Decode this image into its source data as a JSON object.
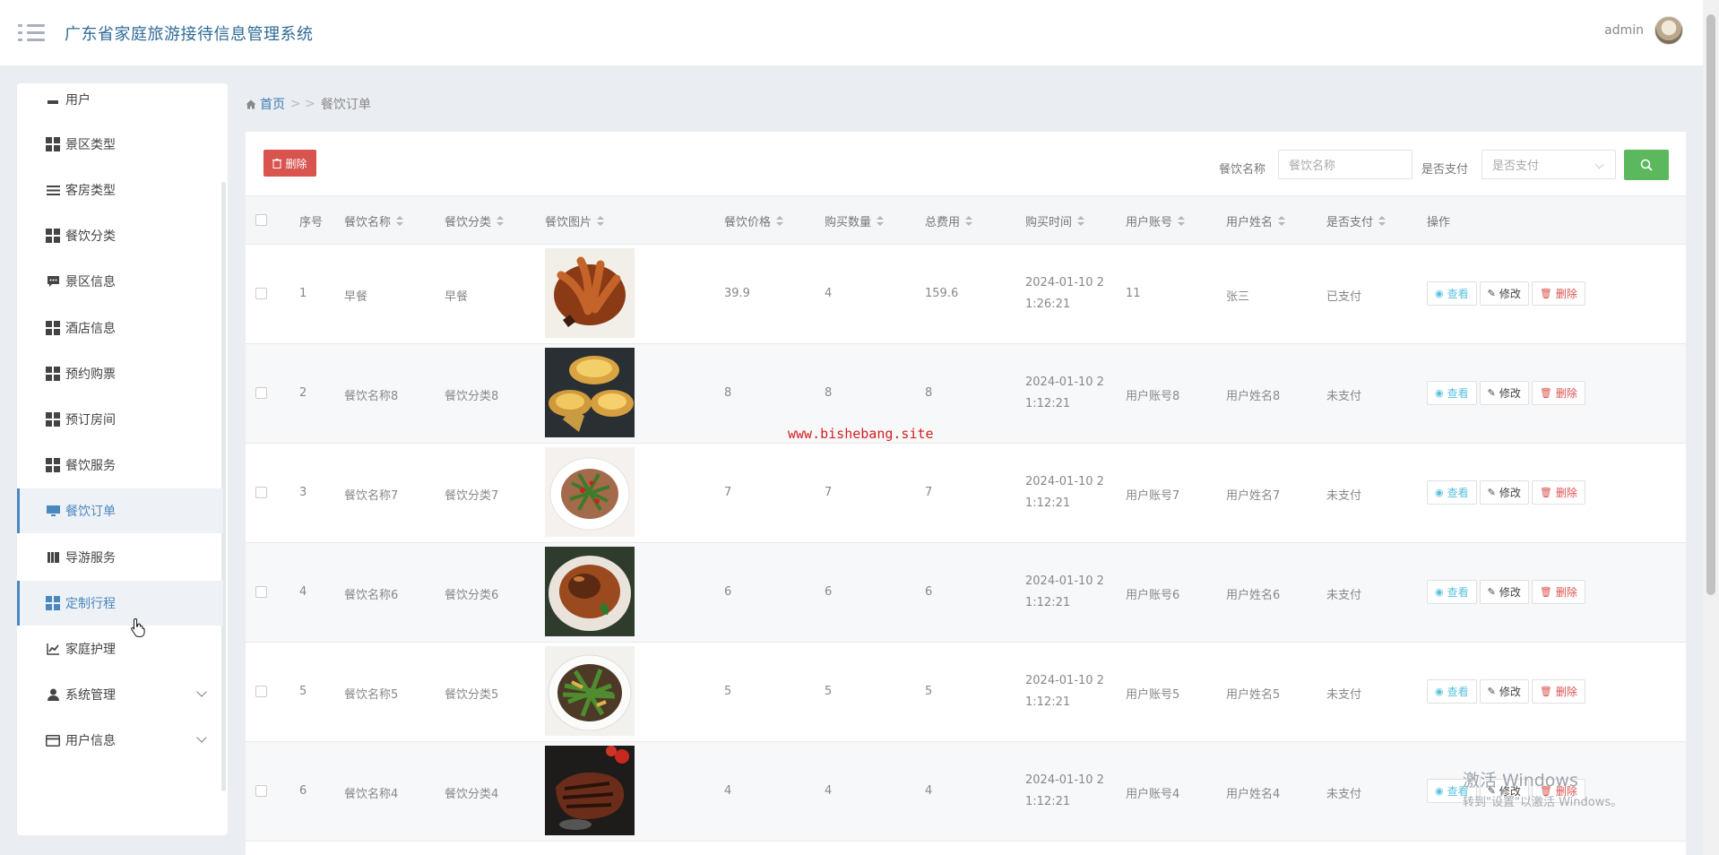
{
  "header": {
    "title": "广东省家庭旅游接待信息管理系统",
    "username": "admin"
  },
  "sidebar": {
    "items": [
      {
        "label": "用户",
        "icon": "user-icon"
      },
      {
        "label": "景区类型",
        "icon": "grid-icon"
      },
      {
        "label": "客房类型",
        "icon": "list-icon"
      },
      {
        "label": "餐饮分类",
        "icon": "grid-icon"
      },
      {
        "label": "景区信息",
        "icon": "comment-icon"
      },
      {
        "label": "酒店信息",
        "icon": "grid-icon"
      },
      {
        "label": "预约购票",
        "icon": "grid-icon"
      },
      {
        "label": "预订房间",
        "icon": "grid-icon"
      },
      {
        "label": "餐饮服务",
        "icon": "grid-icon"
      },
      {
        "label": "餐饮订单",
        "icon": "monitor-icon",
        "active": true
      },
      {
        "label": "导游服务",
        "icon": "book-icon"
      },
      {
        "label": "定制行程",
        "icon": "grid-icon",
        "active": true
      },
      {
        "label": "家庭护理",
        "icon": "chart-icon"
      },
      {
        "label": "系统管理",
        "icon": "person-icon",
        "expandable": true
      },
      {
        "label": "用户信息",
        "icon": "card-icon",
        "expandable": true
      }
    ]
  },
  "breadcrumb": {
    "home": "首页",
    "separator": "> >",
    "current": "餐饮订单"
  },
  "toolbar": {
    "delete_label": "删除",
    "search_name_label": "餐饮名称",
    "search_name_placeholder": "餐饮名称",
    "search_paid_label": "是否支付",
    "search_paid_placeholder": "是否支付"
  },
  "table": {
    "headers": [
      "序号",
      "餐饮名称",
      "餐饮分类",
      "餐饮图片",
      "餐饮价格",
      "购买数量",
      "总费用",
      "购买时间",
      "用户账号",
      "用户姓名",
      "是否支付",
      "操作"
    ],
    "rows": [
      {
        "no": "1",
        "name": "早餐",
        "category": "早餐",
        "price": "39.9",
        "qty": "4",
        "total": "159.6",
        "time1": "2024-01-10 2",
        "time2": "1:26:21",
        "account": "11",
        "user": "张三",
        "paid": "已支付",
        "image": "braised-chicken-feet"
      },
      {
        "no": "2",
        "name": "餐饮名称8",
        "category": "餐饮分类8",
        "price": "8",
        "qty": "8",
        "total": "8",
        "time1": "2024-01-10 2",
        "time2": "1:12:21",
        "account": "用户账号8",
        "user": "用户姓名8",
        "paid": "未支付",
        "image": "egg-tarts"
      },
      {
        "no": "3",
        "name": "餐饮名称7",
        "category": "餐饮分类7",
        "price": "7",
        "qty": "7",
        "total": "7",
        "time1": "2024-01-10 2",
        "time2": "1:12:21",
        "account": "用户账号7",
        "user": "用户姓名7",
        "paid": "未支付",
        "image": "shredded-salad"
      },
      {
        "no": "4",
        "name": "餐饮名称6",
        "category": "餐饮分类6",
        "price": "6",
        "qty": "6",
        "total": "6",
        "time1": "2024-01-10 2",
        "time2": "1:12:21",
        "account": "用户账号6",
        "user": "用户姓名6",
        "paid": "未支付",
        "image": "braised-meat-sauce"
      },
      {
        "no": "5",
        "name": "餐饮名称5",
        "category": "餐饮分类5",
        "price": "5",
        "qty": "5",
        "total": "5",
        "time1": "2024-01-10 2",
        "time2": "1:12:21",
        "account": "用户账号5",
        "user": "用户姓名5",
        "paid": "未支付",
        "image": "stir-fried-vegetables"
      },
      {
        "no": "6",
        "name": "餐饮名称4",
        "category": "餐饮分类4",
        "price": "4",
        "qty": "4",
        "total": "4",
        "time1": "2024-01-10 2",
        "time2": "1:12:21",
        "account": "用户账号4",
        "user": "用户姓名4",
        "paid": "未支付",
        "image": "grilled-steak"
      }
    ],
    "actions": {
      "view": "查看",
      "edit": "修改",
      "delete": "删除"
    }
  },
  "watermark": "www.bishebang.site",
  "activation": {
    "title": "激活 Windows",
    "subtitle": "转到\"设置\"以激活 Windows。"
  },
  "colors": {
    "accent": "#4a88c0",
    "danger": "#d9534f",
    "success": "#5cb85c",
    "info": "#5bc0de"
  }
}
